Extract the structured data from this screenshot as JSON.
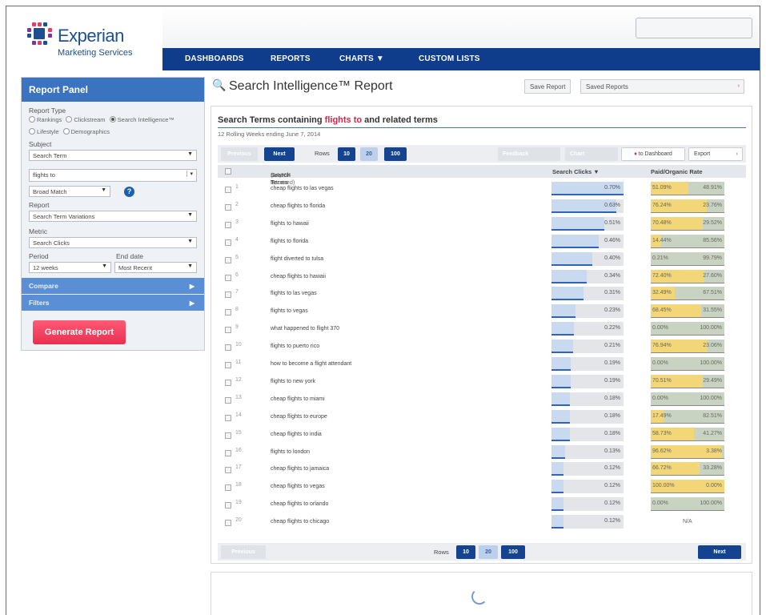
{
  "brand": {
    "name": "Experian",
    "sub": "Marketing Services"
  },
  "nav": [
    "DASHBOARDS",
    "REPORTS",
    "CHARTS ▼",
    "CUSTOM LISTS"
  ],
  "panel": {
    "title": "Report Panel",
    "report_type_label": "Report Type",
    "radios": [
      "Rankings",
      "Clickstream",
      "Search Intelligence™",
      "Lifestyle",
      "Demographics"
    ],
    "subject_label": "Subject",
    "subject_value": "Search Term",
    "term_value": "flights to",
    "match_value": "Broad Match",
    "report_label": "Report",
    "report_value": "Search Term Variations",
    "metric_label": "Metric",
    "metric_value": "Search Clicks",
    "period_label": "Period",
    "period_value": "12 weeks",
    "end_date_label": "End date",
    "end_date_value": "Most Recent",
    "compare_label": "Compare",
    "filters_label": "Filters",
    "generate_label": "Generate Report"
  },
  "main": {
    "title": "Search Intelligence™ Report",
    "save_label": "Save Report",
    "saved_label": "Saved Reports",
    "card_title_pre": "Search Terms containing ",
    "card_title_hl": "flights to",
    "card_title_post": " and related terms",
    "subtitle": "12 Rolling Weeks ending June 7, 2014",
    "previous": "Previous",
    "next": "Next",
    "rows_label": "Rows",
    "rows_options": [
      "10",
      "20",
      "100"
    ],
    "feedback": "Feedback",
    "chart": "Chart",
    "to_dashboard": "to Dashboard",
    "export": "Export",
    "col_terms": "Search Terms",
    "col_terms_count": "(14,954 returned)",
    "col_clicks": "Search Clicks ▼",
    "col_ratio": "Paid/Organic Rate"
  },
  "rows": [
    {
      "n": "1",
      "term": "cheap flights to las vegas",
      "clicks": "0.70%",
      "pct": 0.7,
      "paid": "51.09%",
      "org": "48.91%",
      "p": 51.09
    },
    {
      "n": "2",
      "term": "cheap flights to florida",
      "clicks": "0.63%",
      "pct": 0.63,
      "paid": "76.24%",
      "org": "23.76%",
      "p": 76.24
    },
    {
      "n": "3",
      "term": "flights to hawaii",
      "clicks": "0.51%",
      "pct": 0.51,
      "paid": "70.48%",
      "org": "29.52%",
      "p": 70.48
    },
    {
      "n": "4",
      "term": "flights to florida",
      "clicks": "0.46%",
      "pct": 0.46,
      "paid": "14.44%",
      "org": "85.56%",
      "p": 14.44
    },
    {
      "n": "5",
      "term": "flight diverted to tulsa",
      "clicks": "0.40%",
      "pct": 0.4,
      "paid": "0.21%",
      "org": "99.79%",
      "p": 0.21
    },
    {
      "n": "6",
      "term": "cheap flights to hawaii",
      "clicks": "0.34%",
      "pct": 0.34,
      "paid": "72.40%",
      "org": "27.60%",
      "p": 72.4
    },
    {
      "n": "7",
      "term": "flights to las vegas",
      "clicks": "0.31%",
      "pct": 0.31,
      "paid": "32.49%",
      "org": "67.51%",
      "p": 32.49
    },
    {
      "n": "8",
      "term": "flights to vegas",
      "clicks": "0.23%",
      "pct": 0.23,
      "paid": "68.45%",
      "org": "31.55%",
      "p": 68.45
    },
    {
      "n": "9",
      "term": "what happened to flight 370",
      "clicks": "0.22%",
      "pct": 0.22,
      "paid": "0.00%",
      "org": "100.00%",
      "p": 0
    },
    {
      "n": "10",
      "term": "flights to puerto rico",
      "clicks": "0.21%",
      "pct": 0.21,
      "paid": "76.94%",
      "org": "23.06%",
      "p": 76.94
    },
    {
      "n": "11",
      "term": "how to become a flight attendant",
      "clicks": "0.19%",
      "pct": 0.19,
      "paid": "0.00%",
      "org": "100.00%",
      "p": 0
    },
    {
      "n": "12",
      "term": "flights to new york",
      "clicks": "0.19%",
      "pct": 0.19,
      "paid": "70.51%",
      "org": "29.49%",
      "p": 70.51
    },
    {
      "n": "13",
      "term": "cheap flights to miami",
      "clicks": "0.18%",
      "pct": 0.18,
      "paid": "0.00%",
      "org": "100.00%",
      "p": 0
    },
    {
      "n": "14",
      "term": "cheap flights to europe",
      "clicks": "0.18%",
      "pct": 0.18,
      "paid": "17.49%",
      "org": "82.51%",
      "p": 17.49
    },
    {
      "n": "15",
      "term": "cheap flights to india",
      "clicks": "0.18%",
      "pct": 0.18,
      "paid": "58.73%",
      "org": "41.27%",
      "p": 58.73
    },
    {
      "n": "16",
      "term": "flights to london",
      "clicks": "0.13%",
      "pct": 0.13,
      "paid": "96.62%",
      "org": "3.38%",
      "p": 96.62
    },
    {
      "n": "17",
      "term": "cheap flights to jamaica",
      "clicks": "0.12%",
      "pct": 0.12,
      "paid": "66.72%",
      "org": "33.28%",
      "p": 66.72
    },
    {
      "n": "18",
      "term": "cheap flights to vegas",
      "clicks": "0.12%",
      "pct": 0.12,
      "paid": "100.00%",
      "org": "0.00%",
      "p": 100
    },
    {
      "n": "19",
      "term": "cheap flights to orlando",
      "clicks": "0.12%",
      "pct": 0.12,
      "paid": "0.00%",
      "org": "100.00%",
      "p": 0
    },
    {
      "n": "20",
      "term": "cheap flights to chicago",
      "clicks": "0.12%",
      "pct": 0.12,
      "paid": "",
      "org": "",
      "p": null,
      "na": "N/A"
    }
  ]
}
